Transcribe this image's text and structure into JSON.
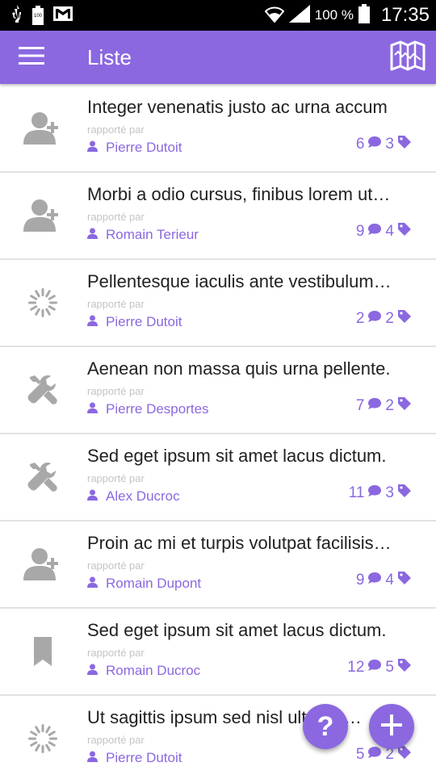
{
  "status_bar": {
    "battery_small_label": "100",
    "battery_percent": "100 %",
    "time": "17:35"
  },
  "app_bar": {
    "title": "Liste",
    "menu_icon": "hamburger-menu-icon",
    "map_icon": "map-icon"
  },
  "reported_by_label": "rapporté par",
  "items": [
    {
      "title": "Integer venenatis justo ac urna accum",
      "author": "Pierre Dutoit",
      "comments": "6",
      "tags": "3",
      "icon": "add-user"
    },
    {
      "title": "Morbi a odio cursus, finibus lorem ut…",
      "author": "Romain Terieur",
      "comments": "9",
      "tags": "4",
      "icon": "add-user"
    },
    {
      "title": "Pellentesque iaculis ante vestibulum…",
      "author": "Pierre Dutoit",
      "comments": "2",
      "tags": "2",
      "icon": "spinner"
    },
    {
      "title": "Aenean non massa quis urna pellente.",
      "author": "Pierre Desportes",
      "comments": "7",
      "tags": "2",
      "icon": "tools"
    },
    {
      "title": "Sed eget ipsum sit amet lacus dictum.",
      "author": "Alex Ducroc",
      "comments": "11",
      "tags": "3",
      "icon": "tools"
    },
    {
      "title": "Proin ac mi et turpis volutpat facilisis…",
      "author": "Romain Dupont",
      "comments": "9",
      "tags": "4",
      "icon": "add-user"
    },
    {
      "title": "Sed eget ipsum sit amet lacus dictum.",
      "author": "Romain Ducroc",
      "comments": "12",
      "tags": "5",
      "icon": "bookmark"
    },
    {
      "title": "Ut sagittis ipsum sed nisl ultrices…",
      "author": "Pierre Dutoit",
      "comments": "5",
      "tags": "2",
      "icon": "spinner"
    }
  ],
  "fab_help_label": "?",
  "colors": {
    "accent": "#8b68e0",
    "icon_grey": "#a8a8a8",
    "divider": "#e2e2e2",
    "reported_label": "#c4c4c4"
  }
}
